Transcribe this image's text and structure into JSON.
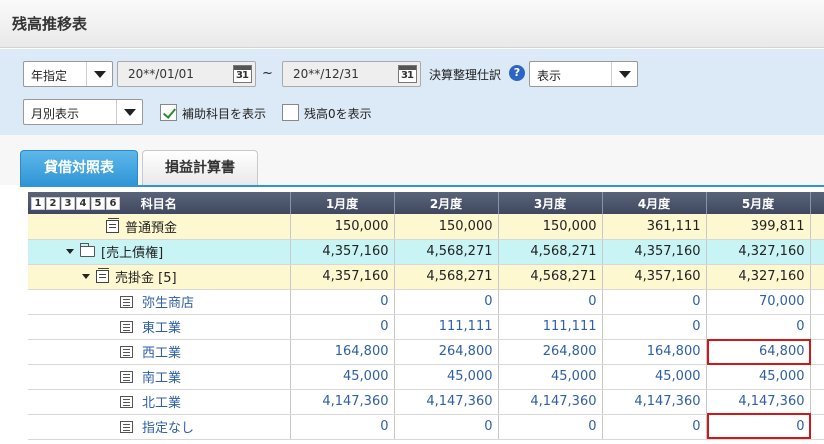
{
  "page": {
    "title": "残高推移表"
  },
  "filters": {
    "period_select": "年指定",
    "date_from": "20**/01/01",
    "calendar_day": "31",
    "tilde": "~",
    "date_to": "20**/12/31",
    "closing_label": "決算整理仕訳",
    "closing_select": "表示",
    "display_select": "月別表示",
    "sub_account_label": "補助科目を表示",
    "sub_account_checked": true,
    "zero_balance_label": "残高0を表示",
    "zero_balance_checked": false
  },
  "tabs": [
    {
      "label": "貸借対照表",
      "active": true
    },
    {
      "label": "損益計算書",
      "active": false
    }
  ],
  "table": {
    "levels": [
      "1",
      "2",
      "3",
      "4",
      "5",
      "6"
    ],
    "columns": [
      "科目名",
      "1月度",
      "2月度",
      "3月度",
      "4月度",
      "5月度"
    ],
    "rows": [
      {
        "name": "普通預金",
        "style": "yellow",
        "icon": "book",
        "indent": 1,
        "values": [
          "150,000",
          "150,000",
          "150,000",
          "361,111",
          "399,811"
        ]
      },
      {
        "name": "[売上債権]",
        "style": "cyan",
        "icon": "folder",
        "indent": 0,
        "expand": true,
        "values": [
          "4,357,160",
          "4,568,271",
          "4,568,271",
          "4,357,160",
          "4,327,160"
        ]
      },
      {
        "name": "売掛金 [5]",
        "style": "yellow",
        "icon": "book",
        "indent": 1,
        "expand": true,
        "values": [
          "4,357,160",
          "4,568,271",
          "4,568,271",
          "4,357,160",
          "4,327,160"
        ]
      },
      {
        "name": "弥生商店",
        "style": "white",
        "icon": "sub",
        "indent": 2,
        "values": [
          "0",
          "0",
          "0",
          "0",
          "70,000"
        ]
      },
      {
        "name": "東工業",
        "style": "white",
        "icon": "sub",
        "indent": 2,
        "values": [
          "0",
          "111,111",
          "111,111",
          "0",
          "0"
        ]
      },
      {
        "name": "西工業",
        "style": "white",
        "icon": "sub",
        "indent": 2,
        "values": [
          "164,800",
          "264,800",
          "264,800",
          "164,800",
          "64,800"
        ]
      },
      {
        "name": "南工業",
        "style": "white",
        "icon": "sub",
        "indent": 2,
        "values": [
          "45,000",
          "45,000",
          "45,000",
          "45,000",
          "45,000"
        ]
      },
      {
        "name": "北工業",
        "style": "white",
        "icon": "sub",
        "indent": 2,
        "values": [
          "4,147,360",
          "4,147,360",
          "4,147,360",
          "4,147,360",
          "4,147,360"
        ]
      },
      {
        "name": "指定なし",
        "style": "white",
        "icon": "sub",
        "indent": 2,
        "values": [
          "0",
          "0",
          "0",
          "0",
          "0"
        ]
      }
    ]
  }
}
